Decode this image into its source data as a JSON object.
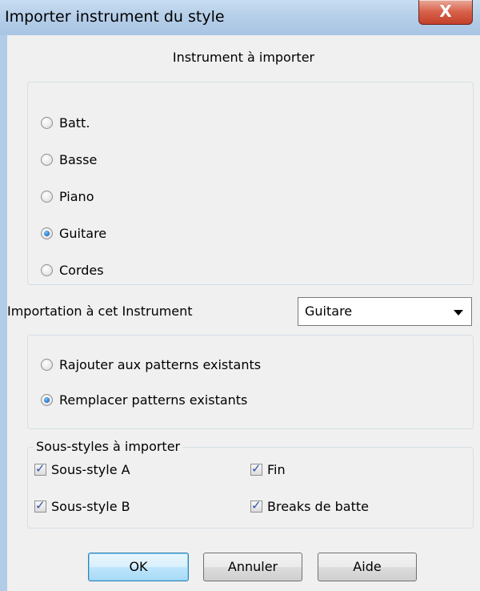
{
  "window": {
    "title": "Importer instrument du style",
    "close_glyph": "X"
  },
  "instrument_group": {
    "heading": "Instrument à importer",
    "options": [
      {
        "label": "Batt.",
        "checked": false
      },
      {
        "label": "Basse",
        "checked": false
      },
      {
        "label": "Piano",
        "checked": false
      },
      {
        "label": "Guitare",
        "checked": true
      },
      {
        "label": "Cordes",
        "checked": false
      }
    ]
  },
  "target": {
    "label": "Importation à cet Instrument",
    "selected": "Guitare"
  },
  "mode_group": {
    "options": [
      {
        "label": "Rajouter aux patterns existants",
        "checked": false
      },
      {
        "label": "Remplacer patterns existants",
        "checked": true
      }
    ]
  },
  "substyles": {
    "legend": "Sous-styles à importer",
    "items": [
      {
        "label": "Sous-style A",
        "checked": true
      },
      {
        "label": "Fin",
        "checked": true
      },
      {
        "label": "Sous-style B",
        "checked": true
      },
      {
        "label": "Breaks de batte",
        "checked": true
      }
    ]
  },
  "buttons": {
    "ok": "OK",
    "cancel": "Annuler",
    "help": "Aide"
  }
}
